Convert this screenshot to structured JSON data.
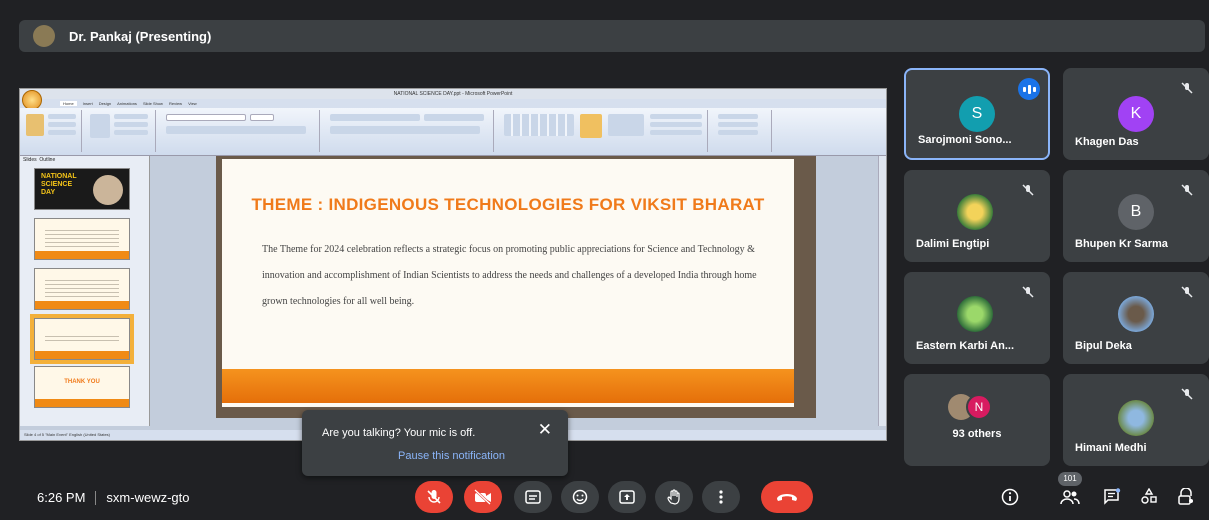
{
  "presenter": {
    "label": "Dr. Pankaj (Presenting)"
  },
  "powerpoint": {
    "window_title": "NATIONAL SCIENCE DAY.ppt - Microsoft PowerPoint",
    "tabs": [
      "Home",
      "Insert",
      "Design",
      "Animations",
      "Slide Show",
      "Review",
      "View"
    ],
    "groups": [
      "Clipboard",
      "Slides",
      "Font",
      "Paragraph",
      "Drawing",
      "Editing"
    ],
    "pane_tabs": [
      "Slides",
      "Outline"
    ],
    "thumb1_text": "NATIONAL SCIENCE DAY",
    "thumb5_text": "THANK YOU",
    "status": "Slide 4 of 5   \"Main Event\"   English (United States)"
  },
  "slide": {
    "title": "THEME :  INDIGENOUS TECHNOLOGIES FOR VIKSIT BHARAT",
    "body": "The Theme for 2024 celebration reflects  a strategic focus on promoting public appreciations for Science and Technology  & innovation and accomplishment of Indian Scientists to address the needs and challenges of a developed India through home grown technologies for all well being."
  },
  "participants": [
    {
      "name": "Sarojmoni Sono...",
      "initial": "S",
      "color": "#129eaf"
    },
    {
      "name": "Khagen Das",
      "initial": "K",
      "color": "#a142f4"
    },
    {
      "name": "Dalimi Engtipi",
      "initial": ""
    },
    {
      "name": "Bhupen Kr Sarma",
      "initial": "B",
      "color": "#5f6368"
    },
    {
      "name": "Eastern Karbi An...",
      "initial": ""
    },
    {
      "name": "Bipul Deka",
      "initial": ""
    },
    {
      "name": "93 others",
      "initial": "N",
      "color": "#d81b60"
    },
    {
      "name": "Himani Medhi",
      "initial": ""
    }
  ],
  "toast": {
    "message": "Are you talking? Your mic is off.",
    "close": "✕",
    "action": "Pause this notification"
  },
  "meeting": {
    "time": "6:26 PM",
    "code": "sxm-wewz-gto",
    "participant_count": "101"
  },
  "colors": {
    "bg": "#202124",
    "tile": "#3c4043",
    "danger": "#ea4335",
    "accent": "#8ab4f8",
    "slide_orange": "#f07a1a"
  }
}
